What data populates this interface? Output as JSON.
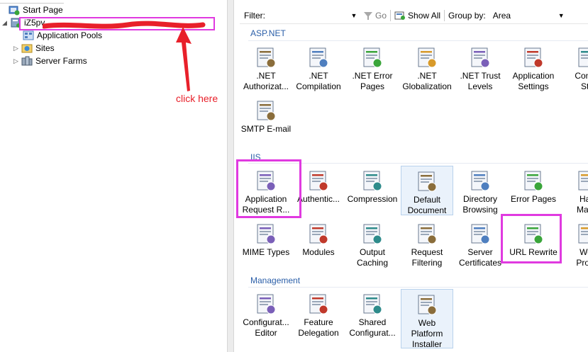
{
  "tree": {
    "items": [
      {
        "label": "Start Page",
        "icon": "start-page-icon"
      },
      {
        "label": "iZ5pv",
        "icon": "server-icon"
      },
      {
        "label": "Application Pools",
        "icon": "app-pools-icon"
      },
      {
        "label": "Sites",
        "icon": "sites-icon"
      },
      {
        "label": "Server Farms",
        "icon": "server-farms-icon"
      }
    ]
  },
  "filterbar": {
    "filter_label": "Filter:",
    "go_label": "Go",
    "show_all_label": "Show All",
    "group_by_label": "Group by:",
    "group_by_value": "Area"
  },
  "groups": [
    {
      "title": "ASP.NET"
    },
    {
      "title": "IIS"
    },
    {
      "title": "Management"
    }
  ],
  "features": {
    "aspnet": [
      {
        "label": ".NET\nAuthorizat...",
        "icon": "net-authorization-icon"
      },
      {
        "label": ".NET\nCompilation",
        "icon": "net-compilation-icon"
      },
      {
        "label": ".NET Error\nPages",
        "icon": "net-error-pages-icon"
      },
      {
        "label": ".NET\nGlobalization",
        "icon": "net-globalization-icon"
      },
      {
        "label": ".NET Trust\nLevels",
        "icon": "net-trust-levels-icon"
      },
      {
        "label": "Application\nSettings",
        "icon": "application-settings-icon"
      },
      {
        "label": "Conne\nStri",
        "icon": "connection-strings-icon"
      },
      {
        "label": "SMTP E-mail",
        "icon": "smtp-email-icon"
      }
    ],
    "iis": [
      {
        "label": "Application\nRequest R...",
        "icon": "application-request-routing-icon"
      },
      {
        "label": "Authentic...",
        "icon": "authentication-icon"
      },
      {
        "label": "Compression",
        "icon": "compression-icon"
      },
      {
        "label": "Default\nDocument",
        "icon": "default-document-icon"
      },
      {
        "label": "Directory\nBrowsing",
        "icon": "directory-browsing-icon"
      },
      {
        "label": "Error Pages",
        "icon": "error-pages-icon"
      },
      {
        "label": "Han\nMapp",
        "icon": "handler-mappings-icon"
      },
      {
        "label": "MIME Types",
        "icon": "mime-types-icon"
      },
      {
        "label": "Modules",
        "icon": "modules-icon"
      },
      {
        "label": "Output\nCaching",
        "icon": "output-caching-icon"
      },
      {
        "label": "Request\nFiltering",
        "icon": "request-filtering-icon"
      },
      {
        "label": "Server\nCertificates",
        "icon": "server-certificates-icon"
      },
      {
        "label": "URL Rewrite",
        "icon": "url-rewrite-icon"
      },
      {
        "label": "Wor\nProce",
        "icon": "worker-processes-icon"
      }
    ],
    "management": [
      {
        "label": "Configurat...\nEditor",
        "icon": "configuration-editor-icon"
      },
      {
        "label": "Feature\nDelegation",
        "icon": "feature-delegation-icon"
      },
      {
        "label": "Shared\nConfigurat...",
        "icon": "shared-configuration-icon"
      },
      {
        "label": "Web\nPlatform\nInstaller",
        "icon": "web-platform-installer-icon"
      }
    ]
  },
  "annotation": {
    "note": "click here",
    "highlight_color": "#e03ae0",
    "note_color": "#e8202a"
  },
  "colors": {
    "group_title": "#2a5ea8",
    "selected_tile_bg": "#eaf2fb"
  }
}
